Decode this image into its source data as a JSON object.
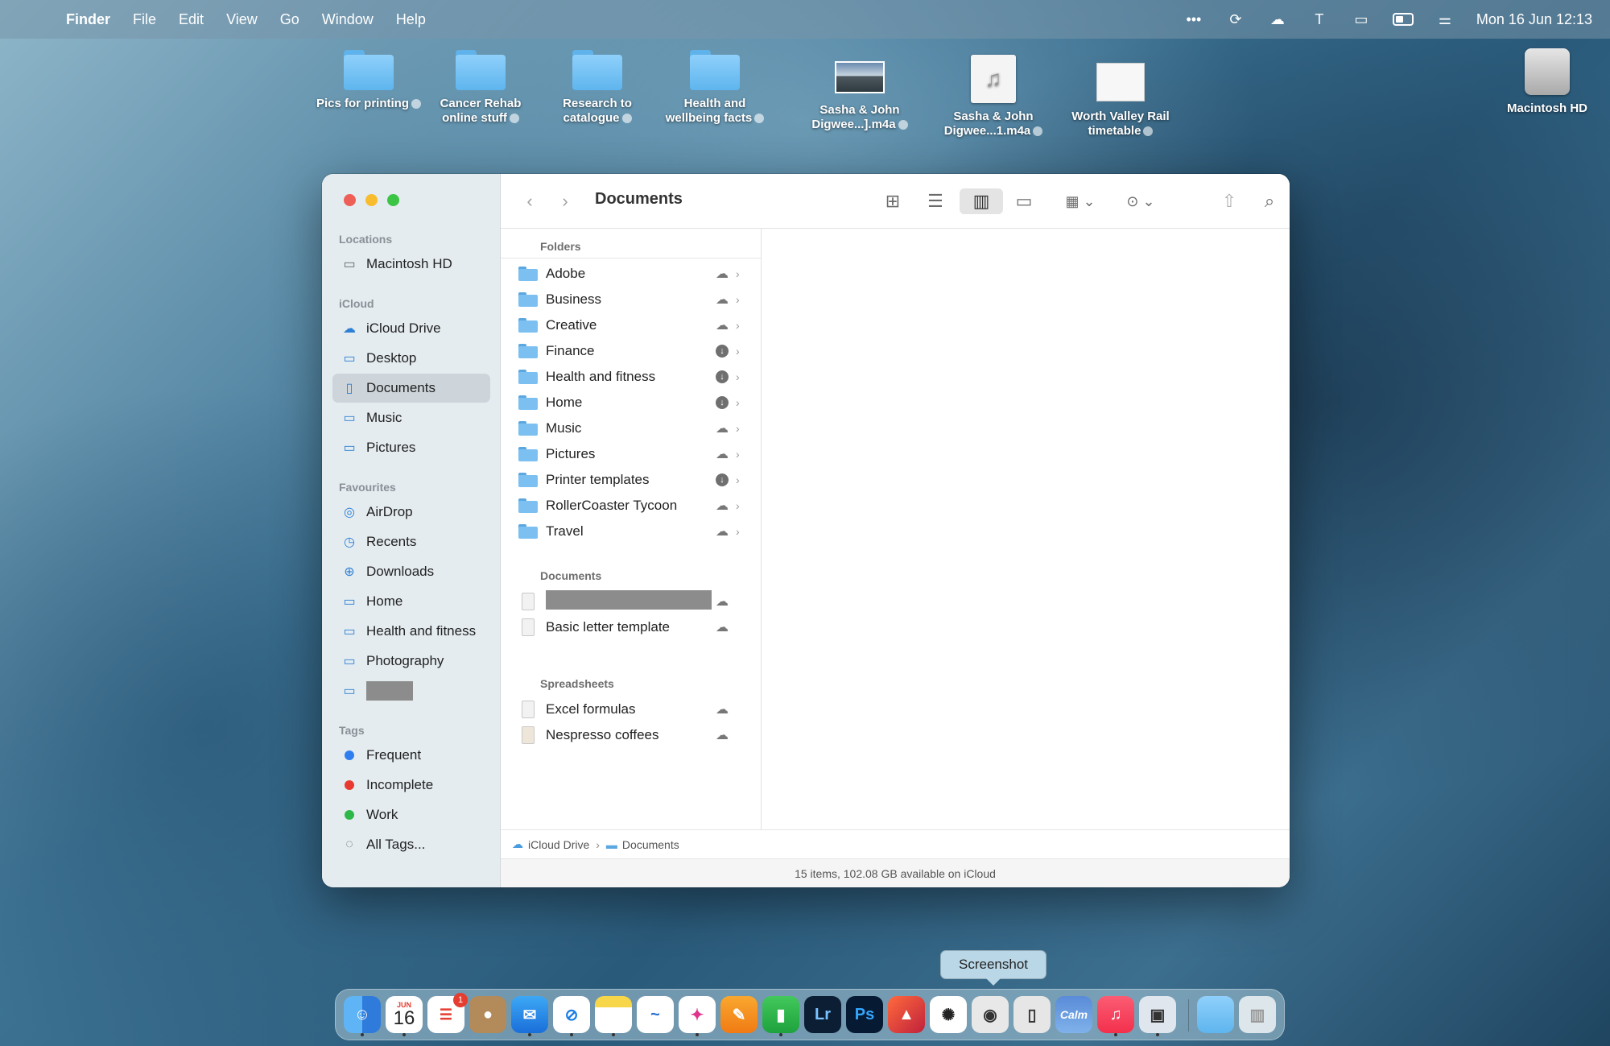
{
  "menubar": {
    "app_name": "Finder",
    "menus": [
      "File",
      "Edit",
      "View",
      "Go",
      "Window",
      "Help"
    ],
    "clock": "Mon 16 Jun  12:13"
  },
  "desktop": {
    "icons": [
      {
        "label": "Pics for printing",
        "kind": "folder"
      },
      {
        "label": "Cancer Rehab online stuff",
        "kind": "folder"
      },
      {
        "label": "Research to catalogue",
        "kind": "folder"
      },
      {
        "label": "Health and wellbeing facts",
        "kind": "folder"
      },
      {
        "label": "Sasha & John Digwee...].m4a",
        "kind": "photo"
      },
      {
        "label": "Sasha & John Digwee...1.m4a",
        "kind": "audio"
      },
      {
        "label": "Worth Valley Rail timetable",
        "kind": "document"
      }
    ],
    "drive_label": "Macintosh HD"
  },
  "finder": {
    "title": "Documents",
    "sidebar": {
      "locations_header": "Locations",
      "locations": [
        "Macintosh HD"
      ],
      "icloud_header": "iCloud",
      "icloud": [
        "iCloud Drive",
        "Desktop",
        "Documents",
        "Music",
        "Pictures"
      ],
      "favourites_header": "Favourites",
      "favourites": [
        "AirDrop",
        "Recents",
        "Downloads",
        "Home",
        "Health and fitness",
        "Photography"
      ],
      "tags_header": "Tags",
      "tags": [
        {
          "label": "Frequent",
          "color": "#2f7ef0"
        },
        {
          "label": "Incomplete",
          "color": "#e83a30"
        },
        {
          "label": "Work",
          "color": "#2eb84a"
        },
        {
          "label": "All Tags...",
          "color": ""
        }
      ]
    },
    "column": {
      "folders_header": "Folders",
      "folders": [
        {
          "name": "Adobe",
          "state": "cloud"
        },
        {
          "name": "Business",
          "state": "cloud"
        },
        {
          "name": "Creative",
          "state": "cloud"
        },
        {
          "name": "Finance",
          "state": "downloading"
        },
        {
          "name": "Health and fitness",
          "state": "downloading"
        },
        {
          "name": "Home",
          "state": "downloading"
        },
        {
          "name": "Music",
          "state": "cloud"
        },
        {
          "name": "Pictures",
          "state": "cloud"
        },
        {
          "name": "Printer templates",
          "state": "downloading"
        },
        {
          "name": "RollerCoaster Tycoon",
          "state": "cloud"
        },
        {
          "name": "Travel",
          "state": "cloud"
        }
      ],
      "documents_header": "Documents",
      "documents": [
        "Basic letter template"
      ],
      "spreadsheets_header": "Spreadsheets",
      "spreadsheets": [
        "Excel formulas",
        "Nespresso coffees"
      ]
    },
    "pathbar": [
      "iCloud Drive",
      "Documents"
    ],
    "status": "15 items, 102.08 GB available on iCloud"
  },
  "tooltip": "Screenshot",
  "dock": {
    "calendar_month": "JUN",
    "calendar_day": "16",
    "reminders_badge": "1",
    "apps": [
      "finder",
      "calendar",
      "reminders",
      "contacts",
      "mail",
      "safari",
      "notes",
      "freeform",
      "launchpad",
      "pages",
      "numbers",
      "lightroom",
      "photoshop",
      "affinity",
      "chatgpt",
      "screenshot",
      "iphone-mirroring",
      "calm",
      "music",
      "preview",
      "downloads",
      "trash"
    ],
    "labels": {
      "lightroom": "Lr",
      "photoshop": "Ps",
      "calm": "Calm"
    }
  }
}
